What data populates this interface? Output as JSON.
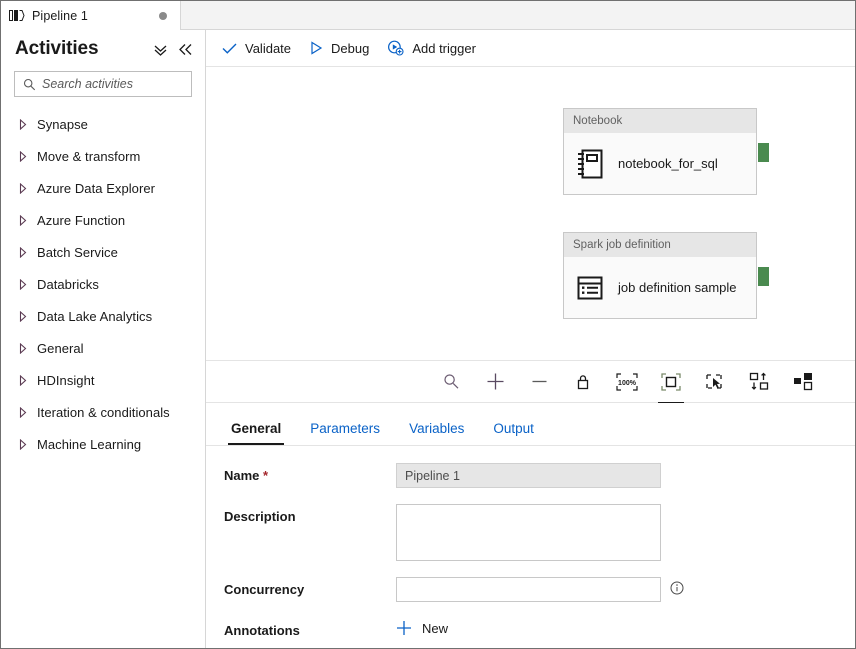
{
  "window": {
    "tab": {
      "label": "Pipeline 1",
      "icon": "pipeline-icon",
      "unsaved_dot": true
    }
  },
  "sidebar": {
    "title": "Activities",
    "actions": [
      {
        "name": "collapse-all-icon",
        "glyph": "chevron-double-down"
      },
      {
        "name": "collapse-panel-icon",
        "glyph": "chevron-double-left"
      }
    ],
    "search": {
      "placeholder": "Search activities",
      "value": "",
      "icon": "search-icon"
    },
    "categories": [
      {
        "label": "Synapse"
      },
      {
        "label": "Move & transform"
      },
      {
        "label": "Azure Data Explorer"
      },
      {
        "label": "Azure Function"
      },
      {
        "label": "Batch Service"
      },
      {
        "label": "Databricks"
      },
      {
        "label": "Data Lake Analytics"
      },
      {
        "label": "General"
      },
      {
        "label": "HDInsight"
      },
      {
        "label": "Iteration & conditionals"
      },
      {
        "label": "Machine Learning"
      }
    ]
  },
  "toolbar": {
    "validate": {
      "label": "Validate",
      "icon": "checkmark-icon"
    },
    "debug": {
      "label": "Debug",
      "icon": "play-triangle-icon"
    },
    "add_trigger": {
      "label": "Add trigger",
      "icon": "trigger-add-icon"
    }
  },
  "canvas": {
    "activities": [
      {
        "type": "Notebook",
        "name": "notebook_for_sql",
        "icon": "notebook-icon",
        "output_handle_color": "#4a8a4f"
      },
      {
        "type": "Spark job definition",
        "name": "job definition sample",
        "icon": "spark-job-definition-icon",
        "output_handle_color": "#4a8a4f"
      }
    ],
    "zoom_toolbar": [
      {
        "name": "search-zoom-icon",
        "title": "Zoom"
      },
      {
        "name": "zoom-in-icon",
        "title": "Zoom in"
      },
      {
        "name": "zoom-out-icon",
        "title": "Zoom out"
      },
      {
        "name": "lock-icon",
        "title": "Lock"
      },
      {
        "name": "zoom-level-icon",
        "title": "100%"
      },
      {
        "name": "zoom-to-fit-icon",
        "title": "Zoom to fit"
      },
      {
        "name": "select-region-icon",
        "title": "Select region"
      },
      {
        "name": "auto-align-icon",
        "title": "Auto align"
      },
      {
        "name": "layout-icon",
        "title": "Layout"
      }
    ],
    "zoom_level_label": "100%"
  },
  "properties": {
    "tabs": [
      {
        "label": "General",
        "active": true
      },
      {
        "label": "Parameters",
        "active": false
      },
      {
        "label": "Variables",
        "active": false
      },
      {
        "label": "Output",
        "active": false
      }
    ],
    "fields": {
      "name_label": "Name",
      "name_required_mark": "*",
      "name_value": "Pipeline 1",
      "description_label": "Description",
      "description_value": "",
      "concurrency_label": "Concurrency",
      "concurrency_value": "",
      "concurrency_info_icon": "info-icon",
      "annotations_label": "Annotations",
      "annotations_new_label": "New",
      "annotations_new_icon": "plus-icon"
    }
  },
  "colors": {
    "accent_blue": "#0a62c7",
    "required_red": "#a4262c",
    "success_green": "#4a8a4f",
    "header_grey": "#e6e6e6"
  }
}
